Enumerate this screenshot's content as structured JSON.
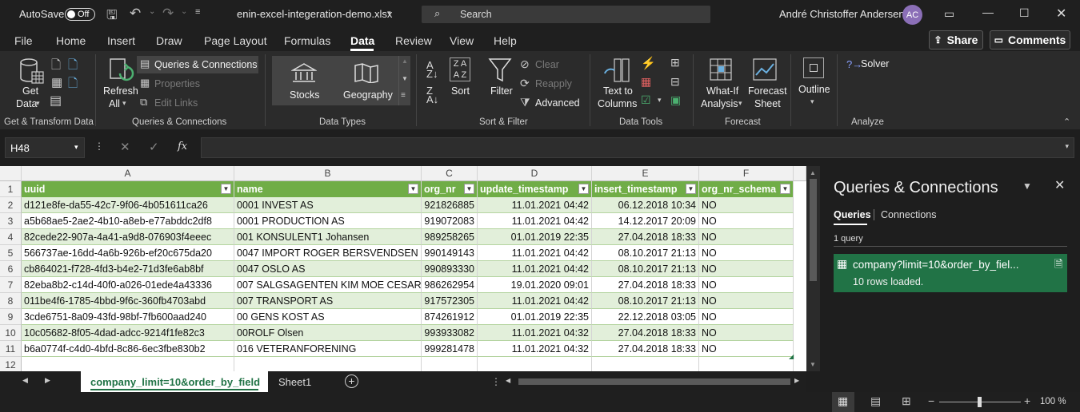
{
  "titlebar": {
    "autosave": "AutoSave",
    "toggle": "Off",
    "filename": "enin-excel-integeration-demo.xlsx",
    "search_placeholder": "Search",
    "user": "André Christoffer Andersen",
    "initials": "AC"
  },
  "menu": {
    "tabs": [
      "File",
      "Home",
      "Insert",
      "Draw",
      "Page Layout",
      "Formulas",
      "Data",
      "Review",
      "View",
      "Help"
    ],
    "active": "Data",
    "share": "Share",
    "comments": "Comments"
  },
  "ribbon": {
    "get_data": "Get",
    "get_data2": "Data",
    "refresh": "Refresh",
    "refresh2": "All",
    "queries_connections": "Queries & Connections",
    "properties": "Properties",
    "edit_links": "Edit Links",
    "stocks": "Stocks",
    "geography": "Geography",
    "sort": "Sort",
    "filter": "Filter",
    "clear": "Clear",
    "reapply": "Reapply",
    "advanced": "Advanced",
    "text_to": "Text to",
    "columns": "Columns",
    "what_if": "What-If",
    "analysis": "Analysis",
    "forecast": "Forecast",
    "sheet": "Sheet",
    "outline": "Outline",
    "solver": "Solver",
    "groups": {
      "g1": "Get & Transform Data",
      "g2": "Queries & Connections",
      "g3": "Data Types",
      "g4": "Sort & Filter",
      "g5": "Data Tools",
      "g6": "Forecast",
      "g7": "Analyze"
    }
  },
  "formula": {
    "namebox": "H48",
    "fx": "fx"
  },
  "sheet": {
    "col_letters": [
      "A",
      "B",
      "C",
      "D",
      "E",
      "F"
    ],
    "headers": [
      "uuid",
      "name",
      "org_nr",
      "update_timestamp",
      "insert_timestamp",
      "org_nr_schema"
    ],
    "row_numbers": [
      "1",
      "2",
      "3",
      "4",
      "5",
      "6",
      "7",
      "8",
      "9",
      "10",
      "11",
      "12"
    ],
    "rows": [
      [
        "d121e8fe-da55-42c7-9f06-4b051611ca26",
        "0001 INVEST AS",
        "921826885",
        "11.01.2021 04:42",
        "06.12.2018 10:34",
        "NO"
      ],
      [
        "a5b68ae5-2ae2-4b10-a8eb-e77abddc2df8",
        "0001 PRODUCTION AS",
        "919072083",
        "11.01.2021 04:42",
        "14.12.2017 20:09",
        "NO"
      ],
      [
        "82cede22-907a-4a41-a9d8-076903f4eeec",
        "001 KONSULENT1 Johansen",
        "989258265",
        "01.01.2019 22:35",
        "27.04.2018 18:33",
        "NO"
      ],
      [
        "566737ae-16dd-4a6b-926b-ef20c675da20",
        "0047 IMPORT ROGER BERSVENDSEN",
        "990149143",
        "11.01.2021 04:42",
        "08.10.2017 21:13",
        "NO"
      ],
      [
        "cb864021-f728-4fd3-b4e2-71d3fe6ab8bf",
        "0047 OSLO AS",
        "990893330",
        "11.01.2021 04:42",
        "08.10.2017 21:13",
        "NO"
      ],
      [
        "82eba8b2-c14d-40f0-a026-01ede4a43336",
        "007 SALGSAGENTEN KIM MOE CESAR",
        "986262954",
        "19.01.2020 09:01",
        "27.04.2018 18:33",
        "NO"
      ],
      [
        "011be4f6-1785-4bbd-9f6c-360fb4703abd",
        "007 TRANSPORT AS",
        "917572305",
        "11.01.2021 04:42",
        "08.10.2017 21:13",
        "NO"
      ],
      [
        "3cde6751-8a09-43fd-98bf-7fb600aad240",
        "00 GENS KOST AS",
        "874261912",
        "01.01.2019 22:35",
        "22.12.2018 03:05",
        "NO"
      ],
      [
        "10c05682-8f05-4dad-adcc-9214f1fe82c3",
        "00ROLF Olsen",
        "993933082",
        "11.01.2021 04:32",
        "27.04.2018 18:33",
        "NO"
      ],
      [
        "b6a0774f-c4d0-4bfd-8c86-6ec3fbe830b2",
        "016 VETERANFORENING",
        "999281478",
        "11.01.2021 04:32",
        "27.04.2018 18:33",
        "NO"
      ]
    ],
    "tabs": [
      "company_limit=10&order_by_field",
      "Sheet1"
    ]
  },
  "pane": {
    "title": "Queries & Connections",
    "tab_queries": "Queries",
    "tab_connections": "Connections",
    "count": "1 query",
    "query_name": "company?limit=10&order_by_fiel...",
    "query_status": "10 rows loaded."
  },
  "status": {
    "zoom": "100 %"
  }
}
